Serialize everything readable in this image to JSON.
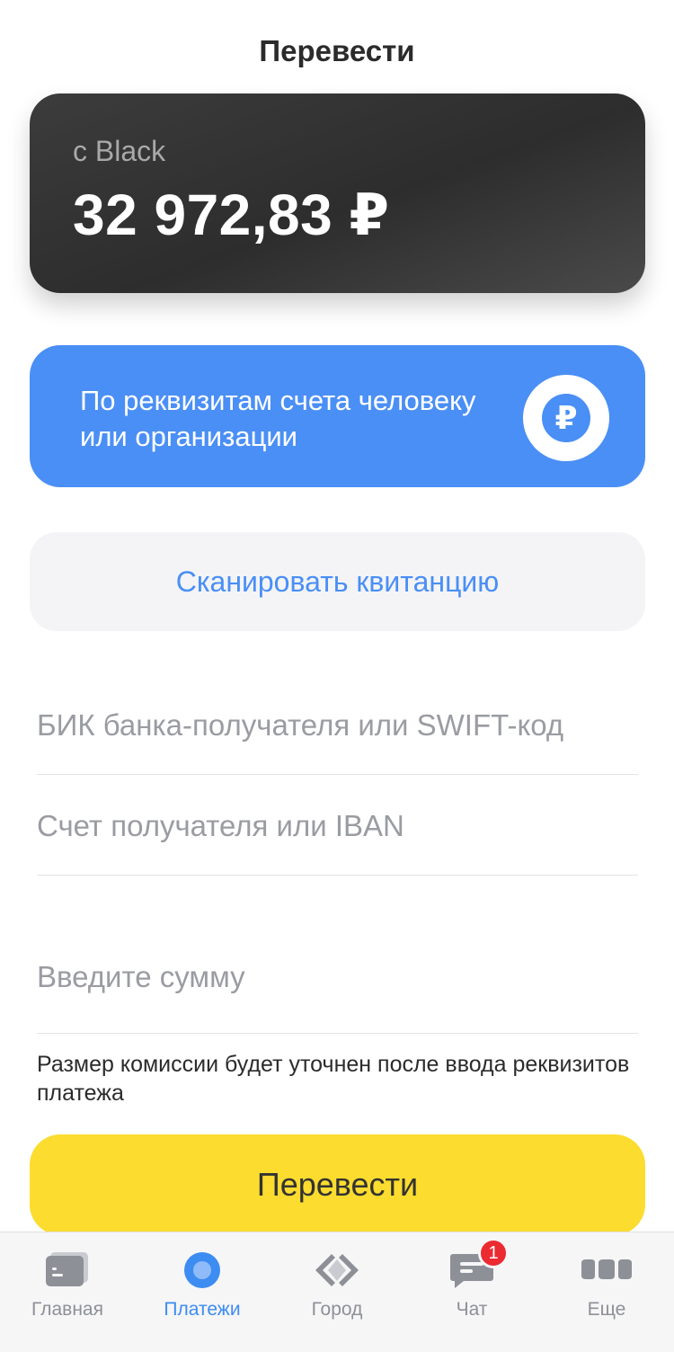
{
  "header": {
    "title": "Перевести"
  },
  "account": {
    "label": "с Black",
    "balance": "32 972,83 ₽"
  },
  "requisites": {
    "text": "По реквизитам счета человеку или организации",
    "icon": "ruble-icon"
  },
  "scan": {
    "label": "Сканировать квитанцию"
  },
  "form": {
    "bik_placeholder": "БИК банка-получателя или SWIFT-код",
    "account_placeholder": "Счет получателя или IBAN",
    "amount_placeholder": "Введите сумму",
    "commission_note": "Размер комиссии будет уточнен после ввода реквизитов платежа"
  },
  "submit": {
    "label": "Перевести"
  },
  "tabbar": {
    "items": [
      {
        "label": "Главная",
        "icon": "card-icon"
      },
      {
        "label": "Платежи",
        "icon": "circle-icon",
        "active": true
      },
      {
        "label": "Город",
        "icon": "city-icon"
      },
      {
        "label": "Чат",
        "icon": "chat-icon",
        "badge": "1"
      },
      {
        "label": "Еще",
        "icon": "more-icon"
      }
    ]
  },
  "colors": {
    "accent": "#4a8ff5",
    "primary_button": "#fcdc2e",
    "badge": "#ec2a32"
  }
}
